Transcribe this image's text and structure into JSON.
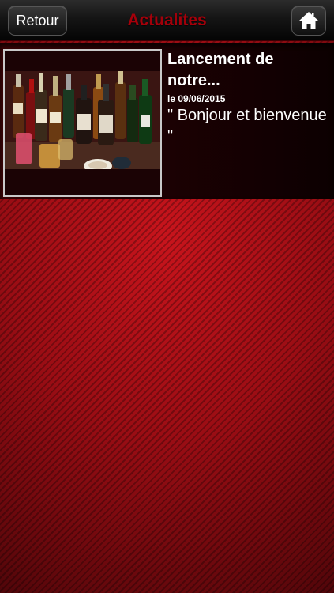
{
  "header": {
    "back_label": "Retour",
    "title": "Actualites",
    "home_icon": "home-icon"
  },
  "news": [
    {
      "title": "Lancement de notre...",
      "date": "le 09/06/2015",
      "excerpt": "\" Bonjour et bienvenue \"",
      "thumbnail": "bottles-photo"
    }
  ],
  "colors": {
    "title_red": "#a4000a",
    "background_red": "#c8141c"
  }
}
